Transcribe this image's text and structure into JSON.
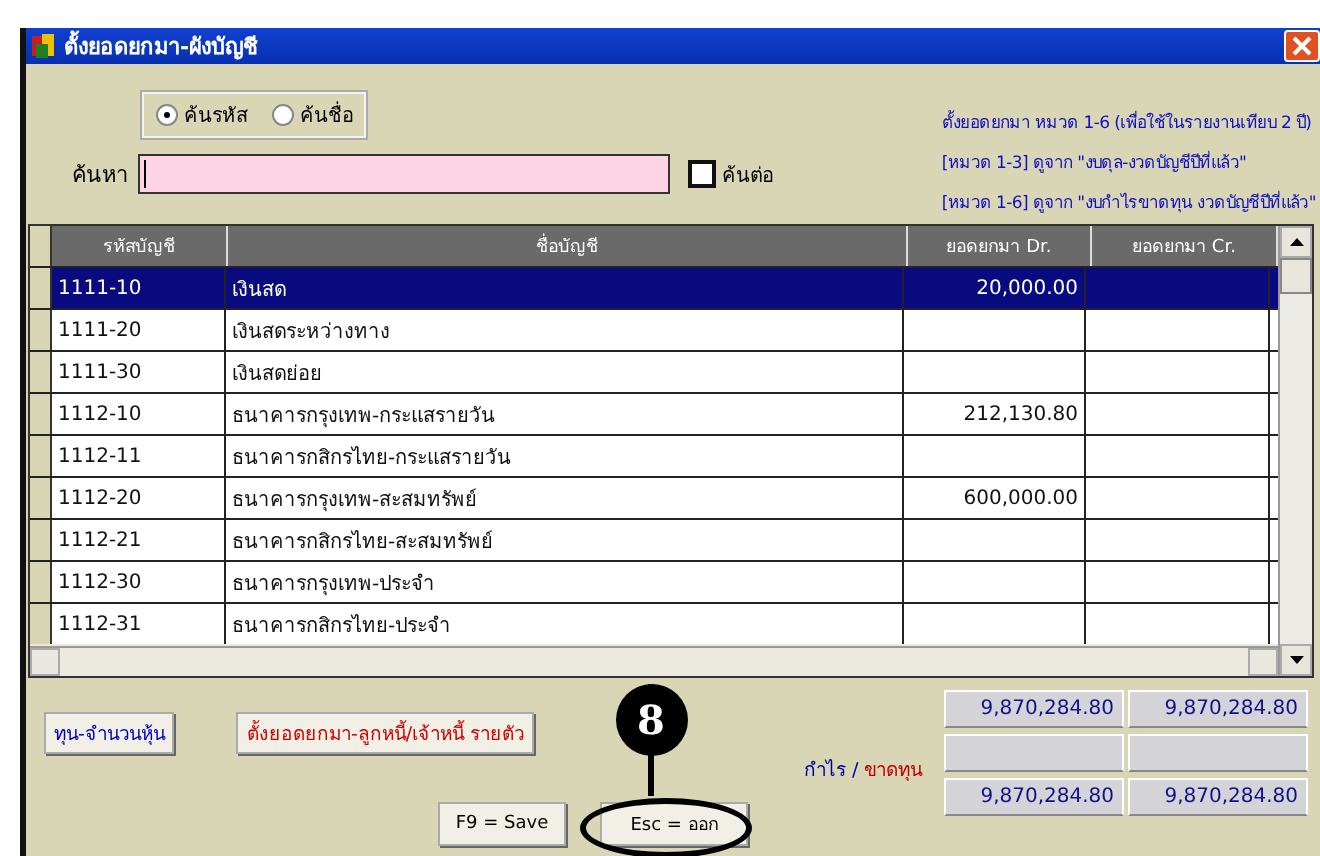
{
  "window": {
    "title": "ตั้งยอดยกมา-ผังบัญชี"
  },
  "search": {
    "modes": [
      {
        "label": "ค้นรหัส",
        "selected": true
      },
      {
        "label": "ค้นชื่อ",
        "selected": false
      }
    ],
    "label": "ค้นหา",
    "next": {
      "label": "ค้นต่อ",
      "checked": false
    }
  },
  "notes": [
    "ตั้งยอดยกมา หมวด 1-6  (เพื่อใช้ในรายงานเทียบ 2 ปี)",
    "[หมวด 1-3]  ดูจาก \"งบดุล-งวดบัญชีปีที่แล้ว\"",
    "[หมวด 1-6]  ดูจาก \"งบกำไรขาดทุน งวดบัญชีปีที่แล้ว\""
  ],
  "table": {
    "columns": [
      "รหัสบัญชี",
      "ชื่อบัญชี",
      "ยอดยกมา Dr.",
      "ยอดยกมา Cr."
    ],
    "rows": [
      {
        "code": "1111-10",
        "name": "เงินสด",
        "dr": "20,000.00",
        "selected": true
      },
      {
        "code": "1111-20",
        "name": "เงินสดระหว่างทาง",
        "selected": false
      },
      {
        "code": "1111-30",
        "name": "เงินสดย่อย",
        "selected": false
      },
      {
        "code": "1112-10",
        "name": "ธนาคารกรุงเทพ-กระแสรายวัน",
        "dr": "212,130.80",
        "selected": false
      },
      {
        "code": "1112-11",
        "name": "ธนาคารกสิกรไทย-กระแสรายวัน",
        "selected": false
      },
      {
        "code": "1112-20",
        "name": "ธนาคารกรุงเทพ-สะสมทรัพย์",
        "dr": "600,000.00",
        "selected": false
      },
      {
        "code": "1112-21",
        "name": "ธนาคารกสิกรไทย-สะสมทรัพย์",
        "selected": false
      },
      {
        "code": "1112-30",
        "name": "ธนาคารกรุงเทพ-ประจำ",
        "selected": false
      },
      {
        "code": "1112-31",
        "name": "ธนาคารกสิกรไทย-ประจำ",
        "selected": false
      }
    ]
  },
  "links": [
    {
      "label": "ทุน-จำนวนหุ้น",
      "kind": "blue"
    },
    {
      "label": "ตั้งยอดยกมา-ลูกหนี้/เจ้าหนี้ รายตัว",
      "kind": "red"
    }
  ],
  "actions": [
    "F9 = Save",
    "Esc = ออก"
  ],
  "totals": {
    "profit_label": "กำไร /",
    "loss_label": "ขาดทุน",
    "rows": [
      {
        "dr": "9,870,284.80",
        "cr": "9,870,284.80"
      },
      {},
      {
        "dr": "9,870,284.80",
        "cr": "9,870,284.80"
      }
    ]
  },
  "callout": {
    "number": "8"
  }
}
